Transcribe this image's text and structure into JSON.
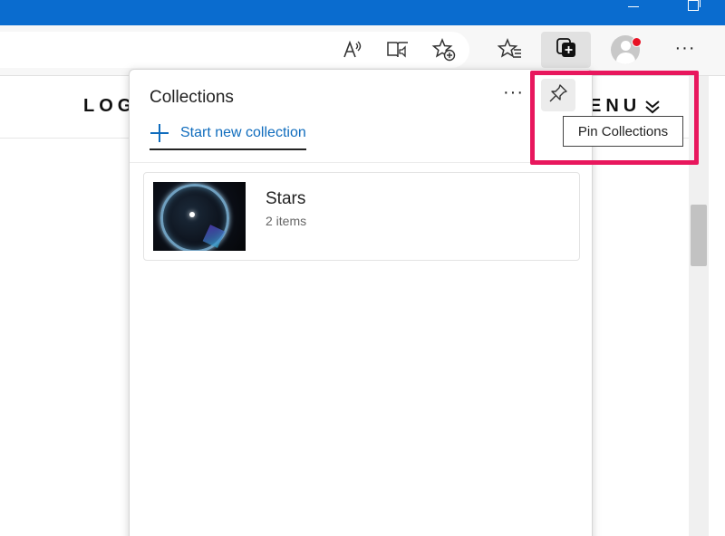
{
  "toolbar": {
    "more_label": "···"
  },
  "page": {
    "logo_text": "LOG",
    "menu_text": "ENU"
  },
  "panel": {
    "title": "Collections",
    "more_label": "···",
    "new_collection_label": "Start new collection",
    "collections": [
      {
        "title": "Stars",
        "subtitle": "2 items"
      }
    ]
  },
  "tooltip": {
    "text": "Pin Collections"
  },
  "colors": {
    "titlebar": "#0a6ccf",
    "accent": "#0f6cbd",
    "highlight": "#e8175d",
    "notification_dot": "#e81123"
  },
  "icons": {
    "read_aloud": "read-aloud-icon",
    "immersive_reader": "immersive-reader-icon",
    "add_favorite": "add-favorite-icon",
    "favorites": "favorites-icon",
    "collections": "collections-icon",
    "profile": "profile-icon",
    "pin": "pin-icon",
    "chevron": "double-chevron-down-icon"
  }
}
